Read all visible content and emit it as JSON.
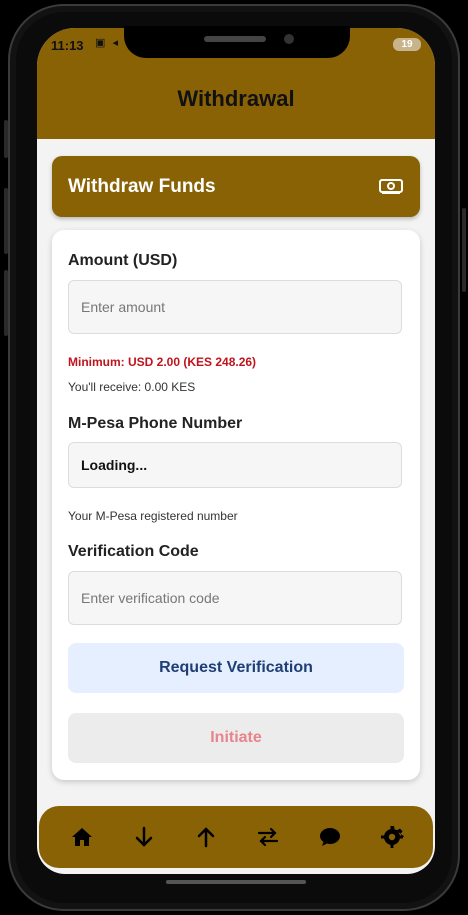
{
  "status": {
    "time": "11:13",
    "battery": "19"
  },
  "header": {
    "title": "Withdrawal"
  },
  "card": {
    "title": "Withdraw Funds"
  },
  "form": {
    "amount_label": "Amount (USD)",
    "amount_placeholder": "Enter amount",
    "minimum_note": "Minimum: USD 2.00 (KES 248.26)",
    "receive_note": "You'll receive: 0.00 KES",
    "phone_label": "M-Pesa Phone Number",
    "phone_value": "Loading...",
    "phone_note": "Your M-Pesa registered number",
    "code_label": "Verification Code",
    "code_placeholder": "Enter verification code",
    "request_button": "Request Verification",
    "initiate_button": "Initiate"
  },
  "nav": [
    "home-icon",
    "arrow-down-icon",
    "arrow-up-icon",
    "swap-icon",
    "chat-icon",
    "gear-icon"
  ],
  "colors": {
    "brand": "#8a6206",
    "error": "#c0141d",
    "verify_bg": "#e6efff",
    "verify_text": "#1f3f74"
  }
}
